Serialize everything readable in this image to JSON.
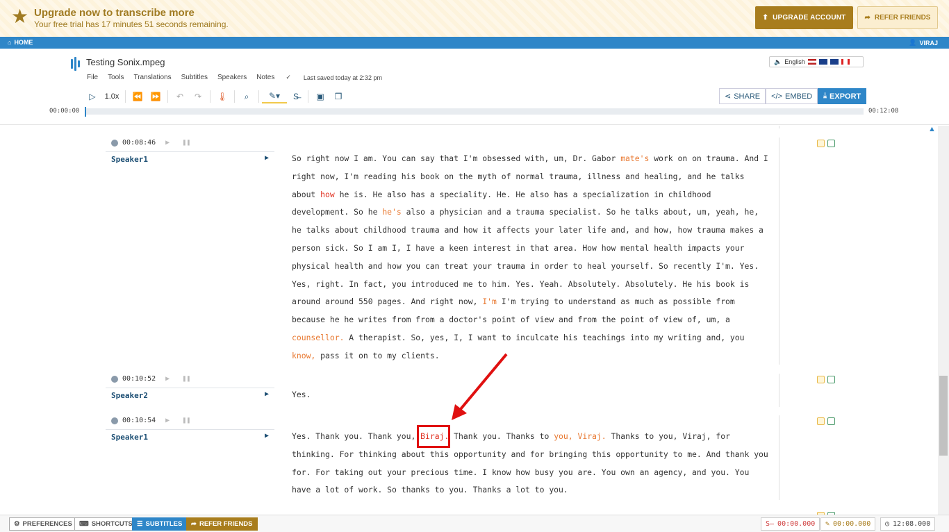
{
  "banner": {
    "title": "Upgrade now to transcribe more",
    "subtitle": "Your free trial has 17 minutes 51 seconds remaining.",
    "upgrade_label": "UPGRADE ACCOUNT",
    "refer_label": "REFER FRIENDS"
  },
  "nav": {
    "home": "HOME",
    "user": "VIRAJ"
  },
  "file": {
    "title": "Testing Sonix.mpeg",
    "menu": [
      "File",
      "Tools",
      "Translations",
      "Subtitles",
      "Speakers",
      "Notes"
    ],
    "saved": "Last saved today at 2:32 pm",
    "rate": "1.0x",
    "language": "English"
  },
  "actions": {
    "share": "SHARE",
    "embed": "EMBED",
    "export": "EXPORT"
  },
  "timeline": {
    "start": "00:00:00",
    "end": "00:12:08",
    "progress": 0.0
  },
  "blocks": [
    {
      "time": "00:08:46",
      "speaker": "Speaker1",
      "segments": [
        {
          "t": "So right now I am. You can say that I'm obsessed with, um, Dr. Gabor ",
          "c": ""
        },
        {
          "t": "mate's",
          "c": "orange"
        },
        {
          "t": " work on on trauma. And I right now, I'm reading his book on the myth of normal trauma, illness and healing, and he talks about ",
          "c": ""
        },
        {
          "t": "how",
          "c": "red"
        },
        {
          "t": " he is. He also has a speciality. He. He also has a specialization in childhood development. So he ",
          "c": ""
        },
        {
          "t": "he's",
          "c": "orange"
        },
        {
          "t": " also a physician and a trauma specialist. So he talks about, um, yeah, he, he talks about childhood trauma and how it affects your later life and, and how, how trauma makes a person sick. So I am I, I have a keen interest in that area. How how mental health impacts your physical health and how you can treat your trauma in order to heal yourself. So recently I'm. Yes. Yes, right. In fact, you introduced me to him. Yes. Yeah. Absolutely. Absolutely. He his book is around around 550 pages. And right now, ",
          "c": ""
        },
        {
          "t": "I'm",
          "c": "orange"
        },
        {
          "t": " I'm trying to understand as much as possible from because he he writes from from a doctor's point of view and from the point of view of, um, a ",
          "c": ""
        },
        {
          "t": "counsellor.",
          "c": "orange"
        },
        {
          "t": " A therapist. So, yes, I, I want to inculcate his teachings into my writing and, you ",
          "c": ""
        },
        {
          "t": "know,",
          "c": "orange"
        },
        {
          "t": " pass it on to my clients.",
          "c": ""
        }
      ]
    },
    {
      "time": "00:10:52",
      "speaker": "Speaker2",
      "segments": [
        {
          "t": "Yes.",
          "c": ""
        }
      ]
    },
    {
      "time": "00:10:54",
      "speaker": "Speaker1",
      "segments": [
        {
          "t": "Yes. Thank you. Thank you, ",
          "c": ""
        },
        {
          "t": "Biraj.",
          "c": "red"
        },
        {
          "t": " Thank you. Thanks to ",
          "c": ""
        },
        {
          "t": "you, Viraj.",
          "c": "orange"
        },
        {
          "t": " Thanks to you, Viraj, for thinking. For thinking about this opportunity and for bringing this opportunity to me. And thank you for. For taking out your precious time. I know how busy you are. You own an agency, and you. You have a lot of work. So thanks to you. Thanks a lot to you.",
          "c": ""
        }
      ]
    }
  ],
  "footer": {
    "preferences": "PREFERENCES",
    "shortcuts": "SHORTCUTS",
    "subtitles": "SUBTITLES",
    "refer": "REFER FRIENDS",
    "strike_time": "00:00.000",
    "pen_time": "00:00.000",
    "clock_time": "12:08.000"
  },
  "colors": {
    "accent": "#2e86c8",
    "gold": "#a87d1d",
    "highlight_red": "#e01010"
  }
}
